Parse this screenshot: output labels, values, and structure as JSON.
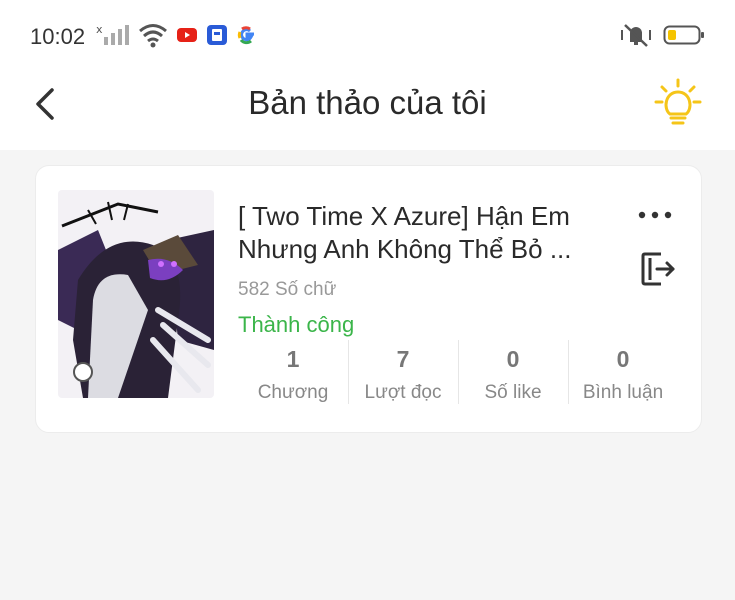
{
  "status_bar": {
    "time": "10:02",
    "icons": [
      "signal-icon",
      "wifi-icon",
      "youtube-icon",
      "app-icon",
      "google-icon",
      "mute-vibrate-icon",
      "battery-icon"
    ]
  },
  "header": {
    "title": "Bản thảo của tôi"
  },
  "story": {
    "title": "[ Two Time X Azure] Hận Em Nhưng Anh Không Thể Bỏ ...",
    "word_count": "582 Số chữ",
    "status": "Thành công",
    "status_color": "#3bb54a",
    "stats": [
      {
        "value": "1",
        "label": "Chương"
      },
      {
        "value": "7",
        "label": "Lượt đọc"
      },
      {
        "value": "0",
        "label": "Số like"
      },
      {
        "value": "0",
        "label": "Bình luận"
      }
    ]
  },
  "colors": {
    "accent_bulb": "#f5c518",
    "success": "#3bb54a",
    "background": "#f5f5f5"
  }
}
